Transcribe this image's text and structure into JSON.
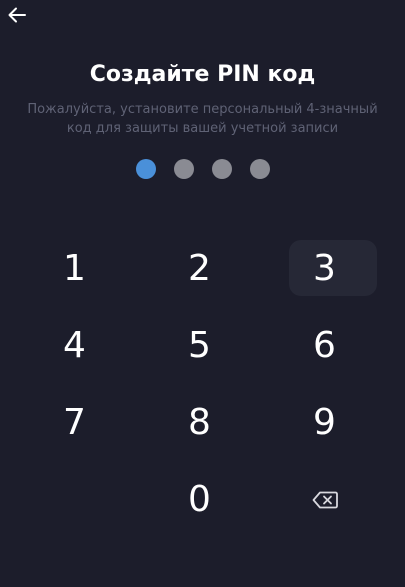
{
  "header": {
    "back_icon": "arrow-left-icon"
  },
  "title": "Создайте PIN код",
  "subtitle_line1": "Пожалуйста, установите персональный 4-значный",
  "subtitle_line2": "код для защиты вашей учетной записи",
  "pin": {
    "length": 4,
    "entered": 1
  },
  "colors": {
    "background": "#1c1d2b",
    "dot_active": "#4a90d9",
    "dot_inactive": "#8a8b93",
    "subtitle": "#5f6275"
  },
  "keys": {
    "k1": "1",
    "k2": "2",
    "k3": "3",
    "k4": "4",
    "k5": "5",
    "k6": "6",
    "k7": "7",
    "k8": "8",
    "k9": "9",
    "k0": "0",
    "backspace_icon": "backspace-icon"
  }
}
